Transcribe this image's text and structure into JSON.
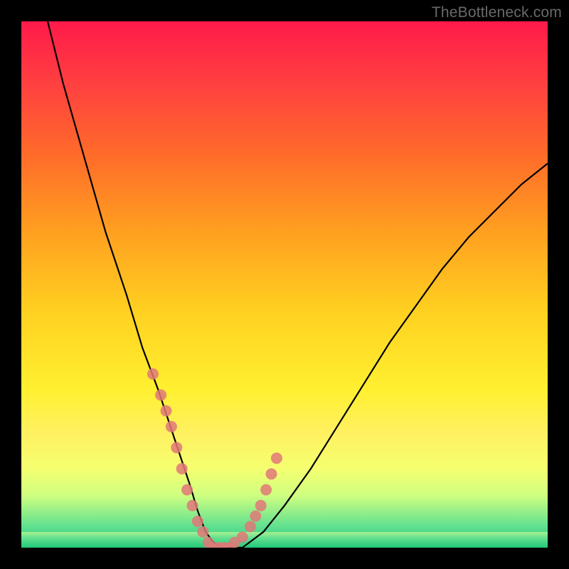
{
  "watermark": "TheBottleneck.com",
  "chart_data": {
    "type": "line",
    "title": "",
    "xlabel": "",
    "ylabel": "",
    "xlim": [
      0,
      100
    ],
    "ylim": [
      0,
      100
    ],
    "grid": false,
    "legend": false,
    "series": [
      {
        "name": "curve",
        "color": "#000000",
        "x": [
          5,
          8,
          12,
          16,
          20,
          23,
          26,
          28,
          30,
          32,
          33.5,
          35,
          36.5,
          38,
          42,
          46,
          50,
          55,
          60,
          65,
          70,
          75,
          80,
          85,
          90,
          95,
          100
        ],
        "y": [
          100,
          88,
          74,
          60,
          48,
          38,
          30,
          24,
          18,
          12,
          7,
          3,
          1,
          0,
          0,
          3,
          8,
          15,
          23,
          31,
          39,
          46,
          53,
          59,
          64,
          69,
          73
        ]
      }
    ],
    "markers": {
      "name": "highlighted-points",
      "color": "#e07878",
      "x": [
        25,
        26.5,
        27.5,
        28.5,
        29.5,
        30.5,
        31.5,
        32.5,
        33.5,
        34.5,
        35.5,
        36.5,
        37.5,
        38.5,
        39.5,
        40.5,
        42,
        43.5,
        44.5,
        45.5,
        46.5,
        47.5,
        48.5
      ],
      "y": [
        33,
        29,
        26,
        23,
        19,
        15,
        11,
        8,
        5,
        3,
        1,
        0,
        0,
        0,
        0,
        1,
        2,
        4,
        6,
        8,
        11,
        14,
        17
      ]
    },
    "background_gradient": {
      "top": "#ff1a4a",
      "mid": "#fff030",
      "bottom": "#20c878"
    }
  }
}
